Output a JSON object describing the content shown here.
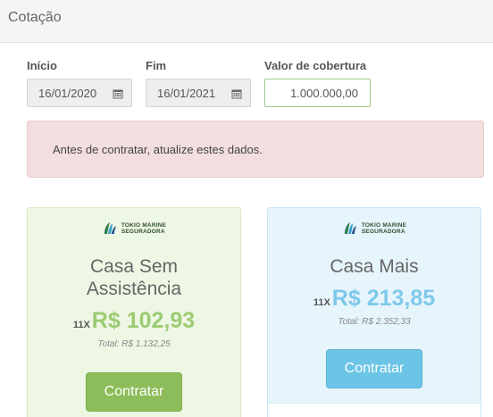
{
  "header": {
    "title": "Cotação"
  },
  "form": {
    "start_label": "Início",
    "start_value": "16/01/2020",
    "end_label": "Fim",
    "end_value": "16/01/2021",
    "coverage_label": "Valor de cobertura",
    "coverage_value": "1.000.000,00"
  },
  "alert": {
    "text": "Antes de contratar, atualize estes dados."
  },
  "colors": {
    "green_accent": "#9ccb72",
    "blue_accent": "#7ec9ea",
    "alert_bg": "#f2dede"
  },
  "plans": [
    {
      "logo_line1": "TOKIO MARINE",
      "logo_line2": "SEGURADORA",
      "name": "Casa Sem Assistência",
      "installments": "11X",
      "price": "R$ 102,93",
      "total": "Total: R$ 1.132,25",
      "button": "Contratar"
    },
    {
      "logo_line1": "TOKIO MARINE",
      "logo_line2": "SEGURADORA",
      "name": "Casa Mais",
      "installments": "11X",
      "price": "R$ 213,85",
      "total": "Total: R$ 2.352,33",
      "button": "Contratar"
    }
  ]
}
